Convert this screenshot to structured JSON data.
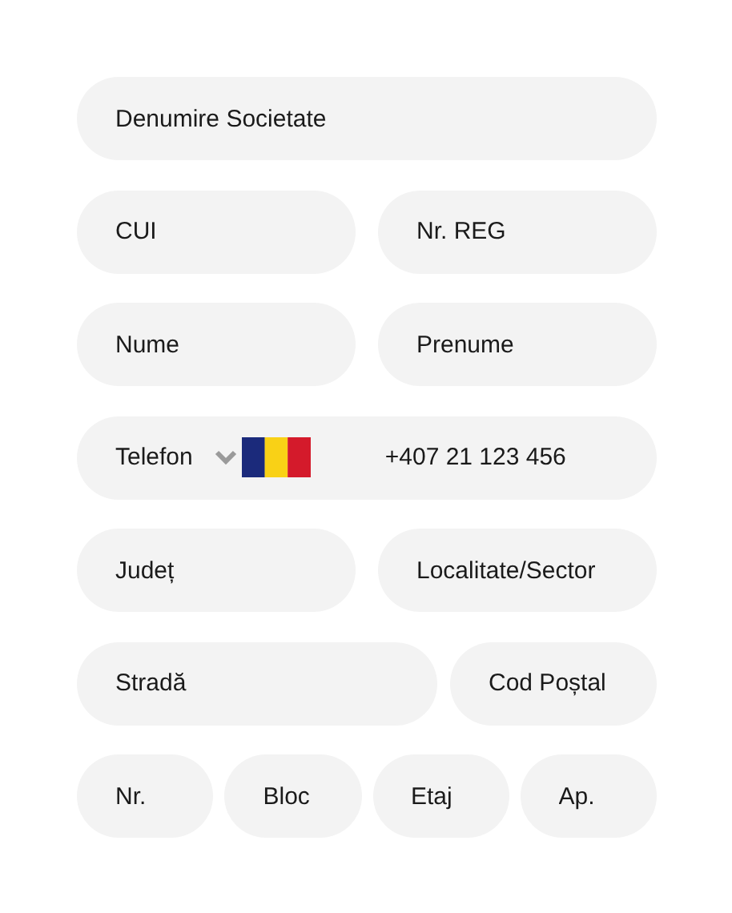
{
  "rows": [
    {
      "fields": [
        {
          "kind": "text",
          "placeholder": "Denumire Societate"
        }
      ]
    },
    {
      "fields": [
        {
          "kind": "text",
          "placeholder": "CUI"
        },
        {
          "kind": "text",
          "placeholder": "Nr. REG"
        }
      ]
    },
    {
      "fields": [
        {
          "kind": "text",
          "placeholder": "Nume"
        },
        {
          "kind": "text",
          "placeholder": "Prenume"
        }
      ]
    },
    {
      "fields": [
        {
          "kind": "phone",
          "label": "Telefon",
          "placeholder": "+407 21 123 456"
        }
      ]
    },
    {
      "fields": [
        {
          "kind": "text",
          "placeholder": "Județ"
        },
        {
          "kind": "text",
          "placeholder": "Localitate/Sector"
        }
      ]
    },
    {
      "fields": [
        {
          "kind": "text",
          "placeholder": "Stradă"
        },
        {
          "kind": "text",
          "placeholder": "Cod Poștal"
        }
      ]
    },
    {
      "fields": [
        {
          "kind": "text",
          "placeholder": "Nr."
        },
        {
          "kind": "text",
          "placeholder": "Bloc"
        },
        {
          "kind": "text",
          "placeholder": "Etaj"
        },
        {
          "kind": "text",
          "placeholder": "Ap."
        }
      ]
    }
  ]
}
